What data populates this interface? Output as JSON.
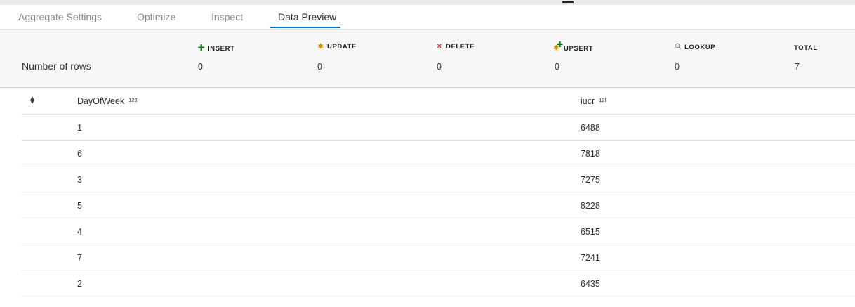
{
  "tabs": [
    {
      "label": "Aggregate Settings"
    },
    {
      "label": "Optimize"
    },
    {
      "label": "Inspect"
    },
    {
      "label": "Data Preview"
    }
  ],
  "active_tab": "Data Preview",
  "summary": {
    "row_label": "Number of rows",
    "columns": [
      {
        "key": "insert",
        "label": "INSERT",
        "icon": "plus-icon",
        "value": "0"
      },
      {
        "key": "update",
        "label": "UPDATE",
        "icon": "asterisk-icon",
        "value": "0"
      },
      {
        "key": "delete",
        "label": "DELETE",
        "icon": "x-icon",
        "value": "0"
      },
      {
        "key": "upsert",
        "label": "UPSERT",
        "icon": "upsert-icon",
        "value": "0"
      },
      {
        "key": "lookup",
        "label": "LOOKUP",
        "icon": "magnifier-icon",
        "value": "0"
      },
      {
        "key": "total",
        "label": "TOTAL",
        "icon": null,
        "value": "7"
      }
    ]
  },
  "table": {
    "columns": [
      {
        "name": "DayOfWeek",
        "type_badge": "123"
      },
      {
        "name": "iucr",
        "type_badge": "12l"
      }
    ],
    "rows": [
      [
        "1",
        "6488"
      ],
      [
        "6",
        "7818"
      ],
      [
        "3",
        "7275"
      ],
      [
        "5",
        "8228"
      ],
      [
        "4",
        "6515"
      ],
      [
        "7",
        "7241"
      ],
      [
        "2",
        "6435"
      ]
    ]
  },
  "colors": {
    "accent": "#0078d4",
    "insert": "#107c10",
    "update": "#d68b00",
    "delete": "#c50f1f"
  }
}
